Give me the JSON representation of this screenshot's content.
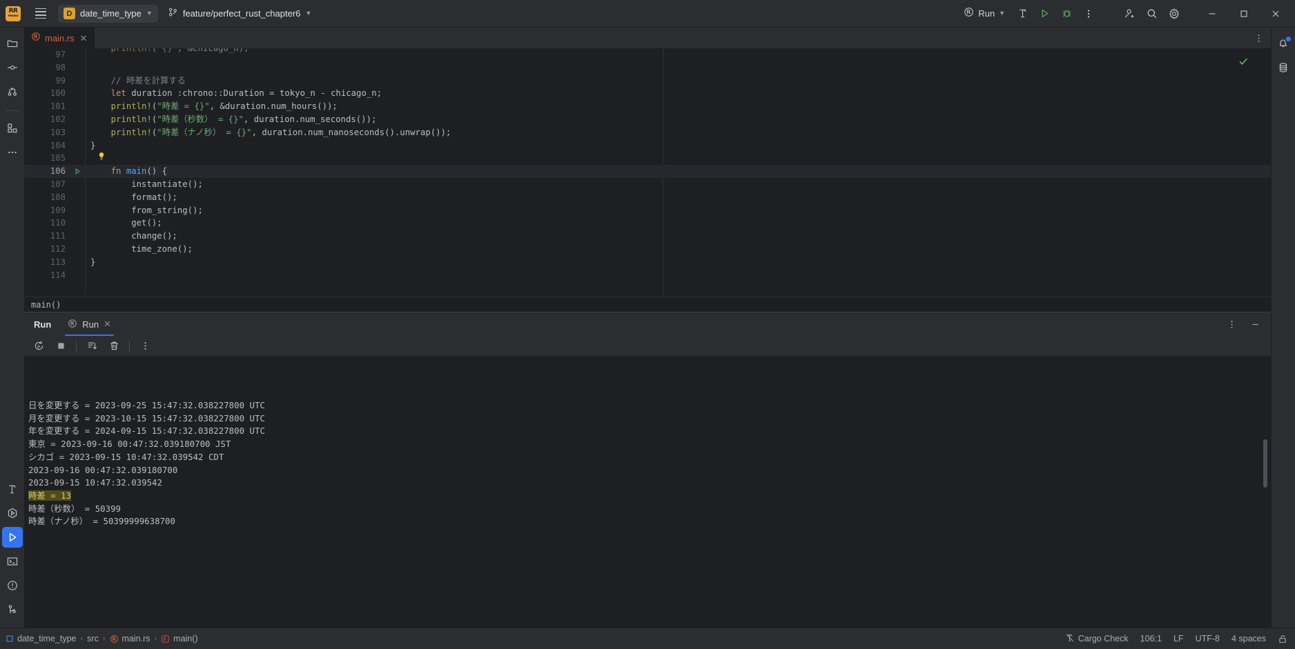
{
  "titlebar": {
    "logo": "RR",
    "logo_sub": "PREVIEW",
    "menu_icon": "hamburger-icon",
    "project_badge": "D",
    "project_name": "date_time_type",
    "branch_icon": "git-branch-icon",
    "branch_name": "feature/perfect_rust_chapter6",
    "run_config": "Run",
    "build_icon": "hammer-icon",
    "run_icon": "run-triangle-icon",
    "debug_icon": "bug-icon",
    "more_icon": "vertical-dots-icon",
    "account_icon": "add-user-icon",
    "search_icon": "search-icon",
    "settings_icon": "gear-icon",
    "minimize": "minimize-icon",
    "maximize": "maximize-icon",
    "close": "close-icon"
  },
  "left_stripe": {
    "top_items": [
      {
        "name": "project-tool-window",
        "icon": "folder-icon"
      },
      {
        "name": "commit-tool-window",
        "icon": "commit-node-icon"
      },
      {
        "name": "pull-requests-tool-window",
        "icon": "pull-request-icon"
      },
      {
        "name": "plugins-tool-window",
        "icon": "squares-icon"
      },
      {
        "name": "more-tool-windows",
        "icon": "ellipsis-icon"
      }
    ],
    "bottom_items": [
      {
        "name": "build-tool-window",
        "icon": "hammer-icon"
      },
      {
        "name": "services-tool-window",
        "icon": "hexagon-play-icon"
      },
      {
        "name": "run-tool-window",
        "icon": "run-triangle-icon",
        "active": true
      },
      {
        "name": "terminal-tool-window",
        "icon": "terminal-icon"
      },
      {
        "name": "problems-tool-window",
        "icon": "exclamation-circle-icon"
      },
      {
        "name": "git-tool-window",
        "icon": "git-branch-icon"
      }
    ]
  },
  "right_stripe": {
    "items": [
      {
        "name": "notifications-tool-window",
        "icon": "bell-icon",
        "badge": true
      },
      {
        "name": "database-tool-window",
        "icon": "database-icon"
      }
    ]
  },
  "editor": {
    "tab": {
      "filename": "main.rs",
      "file_icon": "rust-file-icon",
      "close": "close-icon"
    },
    "tab_options_icon": "vertical-dots-icon",
    "inspection_status": "ok-checkmark",
    "breadcrumb": "main()",
    "first_line": 97,
    "lines": [
      {
        "n": 97,
        "text": "println!(\"{}\", &chicago_n);",
        "clipped": true
      },
      {
        "n": 98,
        "text": ""
      },
      {
        "n": 99,
        "text": "// 時差を計算する"
      },
      {
        "n": 100,
        "text": "let duration :chrono::Duration = tokyo_n - chicago_n;"
      },
      {
        "n": 101,
        "text": "println!(\"時差 = {}\", &duration.num_hours());"
      },
      {
        "n": 102,
        "text": "println!(\"時差（秒数） = {}\", duration.num_seconds());"
      },
      {
        "n": 103,
        "text": "println!(\"時差（ナノ秒） = {}\", duration.num_nanoseconds().unwrap());"
      },
      {
        "n": 104,
        "text": "}"
      },
      {
        "n": 105,
        "text": "",
        "bulb": true
      },
      {
        "n": 106,
        "text": "fn main() {",
        "current": true,
        "gutter_run": true
      },
      {
        "n": 107,
        "text": "instantiate();"
      },
      {
        "n": 108,
        "text": "format();"
      },
      {
        "n": 109,
        "text": "from_string();"
      },
      {
        "n": 110,
        "text": "get();"
      },
      {
        "n": 111,
        "text": "change();"
      },
      {
        "n": 112,
        "text": "time_zone();"
      },
      {
        "n": 113,
        "text": "}"
      },
      {
        "n": 114,
        "text": ""
      }
    ]
  },
  "run_panel": {
    "title": "Run",
    "tab_label": "Run",
    "tab_icon": "rust-run-icon",
    "tab_close": "close-icon",
    "options_icon": "vertical-dots-icon",
    "minimize_icon": "minimize-icon",
    "toolbar": [
      {
        "name": "rerun-button",
        "icon": "rerun-icon"
      },
      {
        "name": "stop-button",
        "icon": "stop-square-icon"
      },
      {
        "name": "scroll-to-end-button",
        "icon": "scroll-end-icon"
      },
      {
        "name": "clear-all-button",
        "icon": "trash-icon"
      },
      {
        "name": "console-options-button",
        "icon": "vertical-dots-icon"
      }
    ],
    "output": [
      {
        "text": "日を変更する = 2023-09-25 15:47:32.038227800 UTC"
      },
      {
        "text": "月を変更する = 2023-10-15 15:47:32.038227800 UTC"
      },
      {
        "text": "年を変更する = 2024-09-15 15:47:32.038227800 UTC"
      },
      {
        "text": "東京 = 2023-09-16 00:47:32.039180700 JST"
      },
      {
        "text": "シカゴ = 2023-09-15 10:47:32.039542 CDT"
      },
      {
        "text": "2023-09-16 00:47:32.039180700"
      },
      {
        "text": "2023-09-15 10:47:32.039542"
      },
      {
        "text": "時差 = 13",
        "highlight": true
      },
      {
        "text": "時差（秒数） = 50399"
      },
      {
        "text": "時差（ナノ秒） = 50399999638700"
      }
    ]
  },
  "statusbar": {
    "crumbs": [
      {
        "label": "date_time_type",
        "icon": "module-icon"
      },
      {
        "label": "src",
        "icon": null
      },
      {
        "label": "main.rs",
        "icon": "rust-file-icon"
      },
      {
        "label": "main()",
        "icon": "function-icon"
      }
    ],
    "cargo_check": "Cargo Check",
    "cargo_check_icon": "cargo-check-disabled-icon",
    "caret": "106:1",
    "line_separator": "LF",
    "encoding": "UTF-8",
    "indent": "4 spaces",
    "lock_icon": "unlocked-icon"
  },
  "colors": {
    "accent": "#3574f0",
    "titlebar_bg": "#2b2d30",
    "editor_bg": "#1e1f22",
    "rust_orange": "#d8623c",
    "green": "#5fad65",
    "highlight_bg": "#4f4b1c"
  }
}
